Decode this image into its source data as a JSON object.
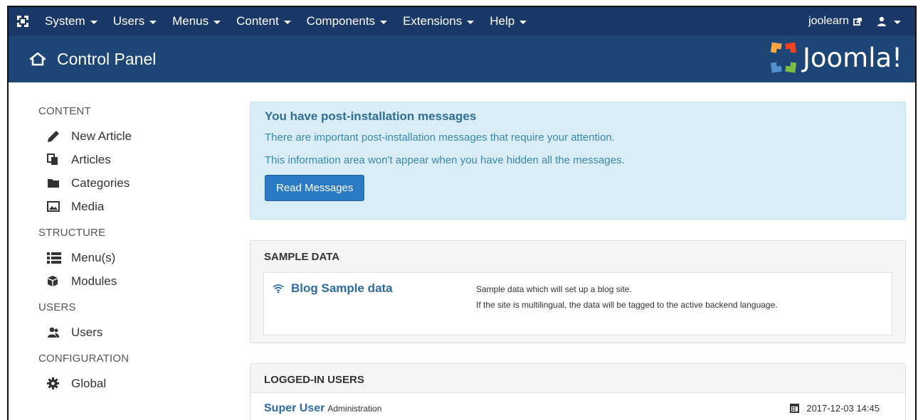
{
  "topbar": {
    "menus": [
      {
        "label": "System"
      },
      {
        "label": "Users"
      },
      {
        "label": "Menus"
      },
      {
        "label": "Content"
      },
      {
        "label": "Components"
      },
      {
        "label": "Extensions"
      },
      {
        "label": "Help"
      }
    ],
    "site_link": "joolearn"
  },
  "titlebar": {
    "title": "Control Panel",
    "logo_text": "Joomla!"
  },
  "sidebar": {
    "groups": [
      {
        "heading": "CONTENT",
        "items": [
          {
            "label": "New Article",
            "icon": "pencil-icon"
          },
          {
            "label": "Articles",
            "icon": "copy-icon"
          },
          {
            "label": "Categories",
            "icon": "folder-icon"
          },
          {
            "label": "Media",
            "icon": "image-icon"
          }
        ]
      },
      {
        "heading": "STRUCTURE",
        "items": [
          {
            "label": "Menu(s)",
            "icon": "list-icon"
          },
          {
            "label": "Modules",
            "icon": "cube-icon"
          }
        ]
      },
      {
        "heading": "USERS",
        "items": [
          {
            "label": "Users",
            "icon": "users-icon"
          }
        ]
      },
      {
        "heading": "CONFIGURATION",
        "items": [
          {
            "label": "Global",
            "icon": "cog-icon"
          }
        ]
      }
    ]
  },
  "alert": {
    "heading": "You have post-installation messages",
    "line1": "There are important post-installation messages that require your attention.",
    "line2": "This information area won't appear when you have hidden all the messages.",
    "button": "Read Messages"
  },
  "sample_data": {
    "heading": "SAMPLE DATA",
    "item_title": "Blog Sample data",
    "desc_line1": "Sample data which will set up a blog site.",
    "desc_line2": "If the site is multilingual, the data will be tagged to the active backend language."
  },
  "logged_in": {
    "heading": "LOGGED-IN USERS",
    "user": "Super User",
    "role": "Administration",
    "time": "2017-12-03 14:45"
  },
  "colors": {
    "navbar": "#1a3867",
    "titlebar": "#1d4677",
    "alert_bg": "#d9edf7",
    "primary": "#2a7ac6",
    "link": "#2d6ba6"
  }
}
